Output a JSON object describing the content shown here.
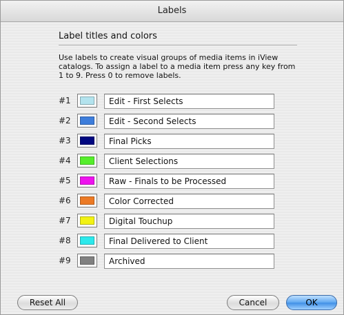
{
  "window": {
    "title": "Labels"
  },
  "section": {
    "title": "Label titles and colors",
    "description": "Use labels to create visual groups of media items in iView catalogs. To assign a label to a media item press any key from 1 to 9. Press 0 to remove labels."
  },
  "labels": [
    {
      "number": "#1",
      "color": "#b3e3ee",
      "title": "Edit - First Selects"
    },
    {
      "number": "#2",
      "color": "#3d7ddb",
      "title": "Edit - Second Selects"
    },
    {
      "number": "#3",
      "color": "#000880",
      "title": "Final Picks"
    },
    {
      "number": "#4",
      "color": "#55ee2b",
      "title": "Client Selections"
    },
    {
      "number": "#5",
      "color": "#ee12ee",
      "title": "Raw - Finals to be Processed"
    },
    {
      "number": "#6",
      "color": "#ec7a25",
      "title": "Color Corrected"
    },
    {
      "number": "#7",
      "color": "#f2f212",
      "title": "Digital Touchup"
    },
    {
      "number": "#8",
      "color": "#2be9ec",
      "title": "Final Delivered to Client"
    },
    {
      "number": "#9",
      "color": "#808080",
      "title": "Archived"
    }
  ],
  "buttons": {
    "reset_all": "Reset All",
    "cancel": "Cancel",
    "ok": "OK"
  }
}
